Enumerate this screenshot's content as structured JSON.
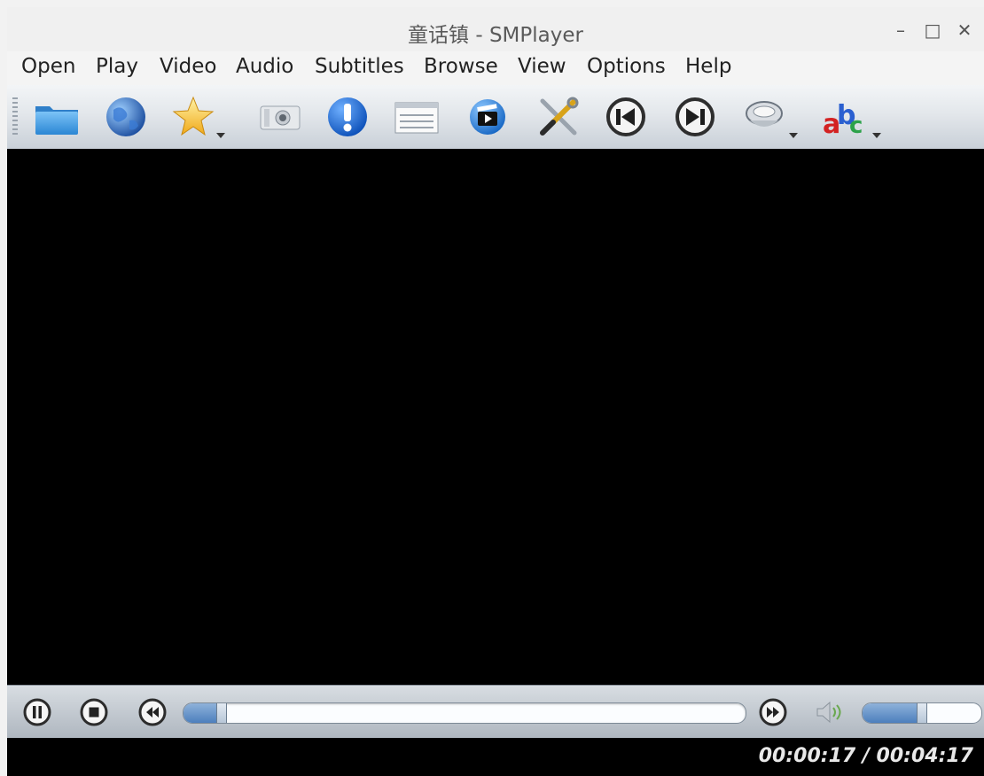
{
  "window": {
    "title": "童话镇 - SMPlayer",
    "minimize_glyph": "–",
    "maximize_glyph": "□",
    "close_glyph": "✕"
  },
  "menu": [
    {
      "label": "Open"
    },
    {
      "label": "Play"
    },
    {
      "label": "Video"
    },
    {
      "label": "Audio"
    },
    {
      "label": "Subtitles"
    },
    {
      "label": "Browse"
    },
    {
      "label": "View"
    },
    {
      "label": "Options"
    },
    {
      "label": "Help"
    }
  ],
  "toolbar": {
    "icons": [
      "folder-icon",
      "globe-icon",
      "favorites-star-icon",
      "screenshot-camera-icon",
      "info-icon",
      "playlist-icon",
      "video-equalizer-icon",
      "preferences-tools-icon",
      "previous-icon",
      "next-icon",
      "audio-track-icon",
      "subtitle-track-icon"
    ]
  },
  "controls": {
    "icons": [
      "pause-icon",
      "stop-icon",
      "rewind-icon",
      "forward-icon",
      "speaker-icon"
    ],
    "seek_progress": 0.068,
    "volume_level": 0.5
  },
  "status": {
    "time": "00:00:17 / 00:04:17"
  },
  "colors": {
    "accent": "#3a7bd5",
    "video_background": "#000000"
  }
}
